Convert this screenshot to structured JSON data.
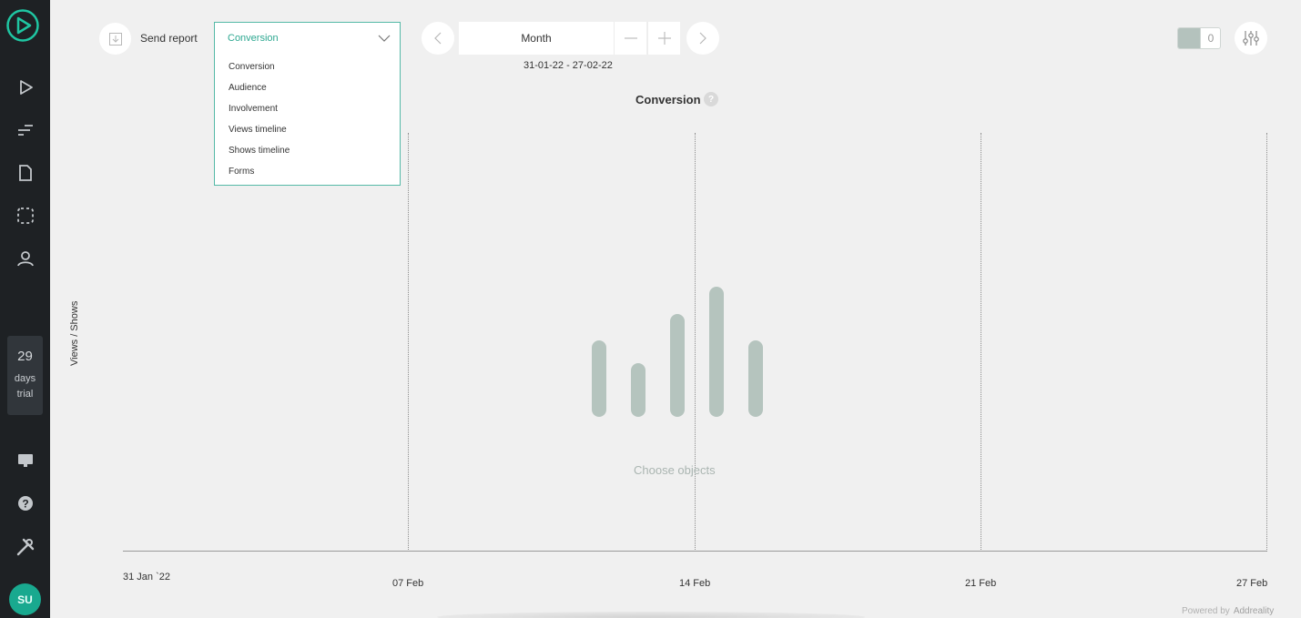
{
  "sidebar": {
    "items": [
      {
        "name": "play-icon"
      },
      {
        "name": "timeline-icon"
      },
      {
        "name": "file-icon"
      },
      {
        "name": "dashed-square-icon"
      },
      {
        "name": "user-icon"
      }
    ],
    "trial": {
      "days": "29",
      "line1": "days",
      "line2": "trial"
    },
    "bottom_items": [
      {
        "name": "monitor-icon"
      },
      {
        "name": "help-icon"
      },
      {
        "name": "tools-icon"
      }
    ],
    "avatar": "SU"
  },
  "toolbar": {
    "send_report": "Send report",
    "report_type": {
      "selected": "Conversion",
      "options": [
        "Conversion",
        "Audience",
        "Involvement",
        "Views timeline",
        "Shows timeline",
        "Forms"
      ]
    },
    "period": "Month",
    "date_range": "31-01-22 - 27-02-22",
    "selected_count": "0"
  },
  "chart": {
    "title": "Conversion",
    "help": "?",
    "ylabel": "Views / Shows",
    "x_ticks": [
      "31 Jan `22",
      "07 Feb",
      "14 Feb",
      "21 Feb",
      "27 Feb"
    ],
    "placeholder": "Choose objects"
  },
  "chart_data": {
    "type": "bar",
    "title": "Conversion",
    "ylabel": "Views / Shows",
    "x_ticks": [
      "31 Jan `22",
      "07 Feb",
      "14 Feb",
      "21 Feb",
      "27 Feb"
    ],
    "placeholder_bars_relative_heights": [
      0.59,
      0.41,
      0.79,
      1.0,
      0.59
    ],
    "grid": true
  },
  "footer": {
    "powered": "Powered by",
    "brand": "Addreality"
  },
  "colors": {
    "accent": "#2ea891",
    "sidebar": "#1e2124",
    "bar": "#b5c4be"
  }
}
